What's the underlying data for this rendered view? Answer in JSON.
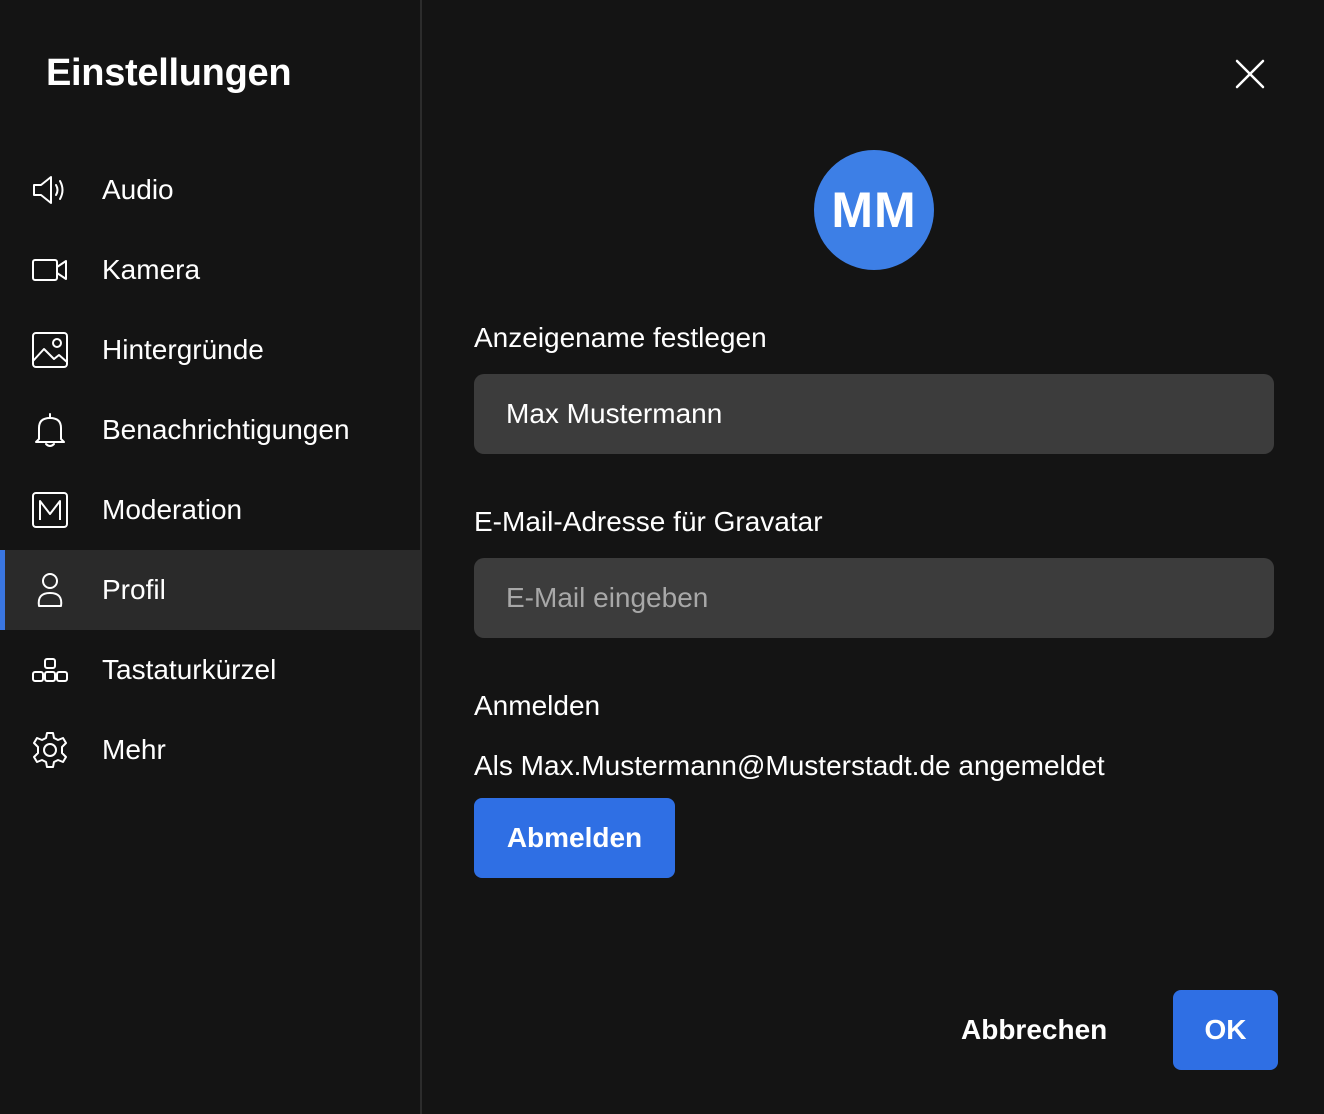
{
  "sidebar": {
    "title": "Einstellungen",
    "items": [
      {
        "label": "Audio",
        "icon": "speaker-icon"
      },
      {
        "label": "Kamera",
        "icon": "camera-icon"
      },
      {
        "label": "Hintergründe",
        "icon": "image-icon"
      },
      {
        "label": "Benachrichtigungen",
        "icon": "bell-icon"
      },
      {
        "label": "Moderation",
        "icon": "moderation-icon"
      },
      {
        "label": "Profil",
        "icon": "user-icon",
        "active": true
      },
      {
        "label": "Tastaturkürzel",
        "icon": "keyboard-shortcuts-icon"
      },
      {
        "label": "Mehr",
        "icon": "gear-icon"
      }
    ]
  },
  "profile": {
    "avatar_initials": "MM",
    "display_name_label": "Anzeigename festlegen",
    "display_name_value": "Max Mustermann",
    "email_label": "E-Mail-Adresse für Gravatar",
    "email_placeholder": "E-Mail eingeben",
    "email_value": "",
    "signin_heading": "Anmelden",
    "signin_status": "Als Max.Mustermann@Musterstadt.de angemeldet",
    "signout_label": "Abmelden"
  },
  "footer": {
    "cancel_label": "Abbrechen",
    "ok_label": "OK"
  },
  "colors": {
    "background": "#141414",
    "accent": "#2f6fe4",
    "input_bg": "#3c3c3c",
    "active_item_bg": "#2a2a2a"
  }
}
